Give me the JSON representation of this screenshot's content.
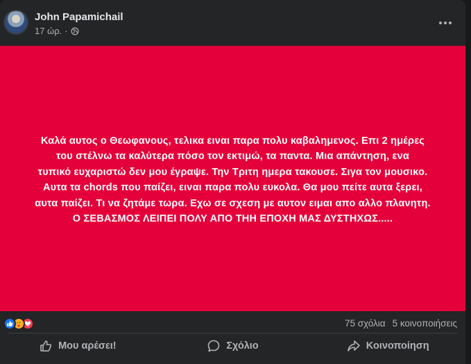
{
  "post": {
    "author": "John Papamichail",
    "time": "17 ώρ.",
    "separator": "·",
    "background_color": "#e4003a",
    "text_lines": [
      "Καλά αυτος ο Θεωφανους, τελικα ειναι παρα πολυ καβαλημενος. Επι 2 ημέρες",
      "του στέλνω τα καλύτερα πόσο τον εκτιμώ, τα παντα. Μια απάντηση, ενα",
      "τυπικό ευχαριστώ δεν μου έγραψε. Την Τριτη ημερα τακουσε. Σιγα τον μουσικο.",
      "Αυτα τα chords που παίζει, ειναι παρα πολυ ευκολα. Θα μου πείτε αυτα ξερει,",
      "αυτα παίζει. Τι να ζητάμε τωρα. Εχω σε σχεση με αυτον ειμαι απο αλλο πλανητη.",
      "Ο ΣΕΒΑΣΜΟΣ ΛΕΙΠΕΙ ΠΟΛΥ ΑΠΟ ΤΗΗ ΕΠΟΧΗ ΜΑΣ ΔΥΣΤΗΧΩΣ....."
    ]
  },
  "reactions": {
    "icons": [
      "like-icon",
      "care-icon",
      "love-icon"
    ],
    "comments": "75 σχόλια",
    "shares": "5 κοινοποιήσεις"
  },
  "actions": {
    "like": "Μου αρέσει!",
    "comment": "Σχόλιο",
    "share": "Κοινοποίηση"
  }
}
